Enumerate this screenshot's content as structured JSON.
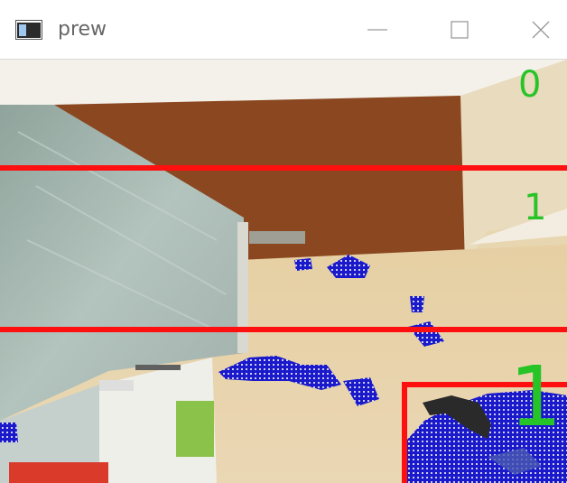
{
  "window": {
    "title": "prew",
    "controls": {
      "minimize_icon": "minimize-icon",
      "maximize_icon": "maximize-icon",
      "close_icon": "close-icon"
    }
  },
  "viewport": {
    "zone_labels": [
      "0",
      "1",
      "1"
    ],
    "colors": {
      "detection_lines": "#ff1010",
      "motion_overlay": "#1a1acc",
      "zone_label": "#26c426"
    }
  }
}
